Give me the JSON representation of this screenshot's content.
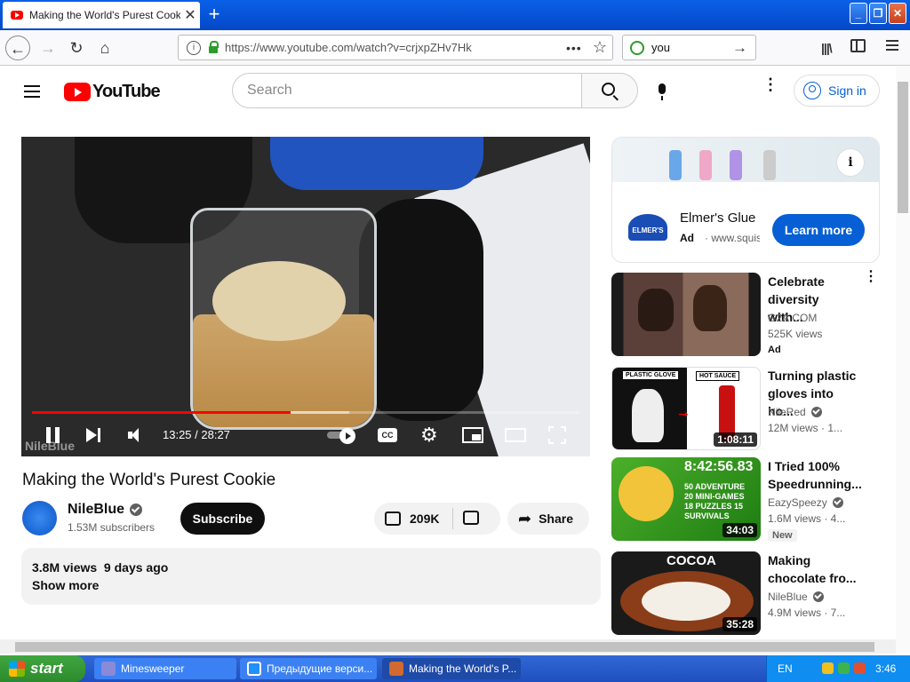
{
  "browser": {
    "tab_title": "Making the World's Purest Cookie",
    "tab_close": "✕",
    "new_tab": "+",
    "url": "https://www.youtube.com/watch?v=crjxpZHv7Hk",
    "url_more": "•••",
    "bookmark_star": "☆",
    "search_text": "you",
    "search_go": "→",
    "library_icon": "|||\\",
    "nav_back": "←",
    "nav_forward": "→",
    "nav_reload": "↻",
    "nav_home": "⌂",
    "window_min": "_",
    "window_max": "❐",
    "window_close": "✕"
  },
  "youtube": {
    "logo_text": "YouTube",
    "search_placeholder": "Search",
    "kebab": "⋮",
    "signin": "Sign in"
  },
  "player": {
    "time": "13:25 / 28:27",
    "played_fraction": 0.472,
    "buffered_fraction": 0.58,
    "watermark": "NileBlue",
    "cc_label": "CC",
    "gear": "⚙"
  },
  "video": {
    "title": "Making the World's Purest Cookie",
    "channel": "NileBlue",
    "subscribers": "1.53M subscribers",
    "subscribe": "Subscribe",
    "likes": "209K",
    "share": "Share",
    "share_icon": "➦",
    "views_date": "3.8M views  9 days ago",
    "show_more": "Show more"
  },
  "ad": {
    "title": "Elmer's Glue",
    "badge": "Ad",
    "domain": "· www.squishy",
    "cta": "Learn more",
    "logo_text": "ELMER'S",
    "info": "i"
  },
  "recommendations": [
    {
      "title": "Celebrate diversity with...",
      "channel": "G2A.COM",
      "views": "525K views",
      "tag": "Ad",
      "verified": false,
      "duration": "",
      "menu": "⋮"
    },
    {
      "title": "Turning plastic gloves into ho...",
      "channel": "NileRed",
      "views": "12M views  ·  1...",
      "tag": "",
      "verified": true,
      "duration": "1:08:11",
      "thumb_label_1": "PLASTIC GLOVE",
      "thumb_label_2": "HOT SAUCE"
    },
    {
      "title": "I Tried 100% Speedrunning...",
      "channel": "EazySpeezy",
      "views": "1.6M views  ·  4...",
      "tag": "New",
      "verified": true,
      "duration": "34:03",
      "thumb_label_1": "8:42:56.83",
      "thumb_label_2": "50 ADVENTURE 20 MINI-GAMES 18 PUZZLES 15 SURVIVALS"
    },
    {
      "title": "Making chocolate fro...",
      "channel": "NileBlue",
      "views": "4.9M views  ·  7...",
      "tag": "",
      "verified": true,
      "duration": "35:28",
      "thumb_label_1": "COCOA"
    }
  ],
  "taskbar": {
    "start": "start",
    "items": [
      "Minesweeper",
      "Предыдущие верси...",
      "Making the World's P..."
    ],
    "lang": "EN",
    "clock": "3:46"
  },
  "colors": {
    "yt_red": "#ff0000",
    "link_blue": "#065fd4",
    "taskbar_blue": "#1f4fc0",
    "start_green": "#2d8a2d"
  }
}
